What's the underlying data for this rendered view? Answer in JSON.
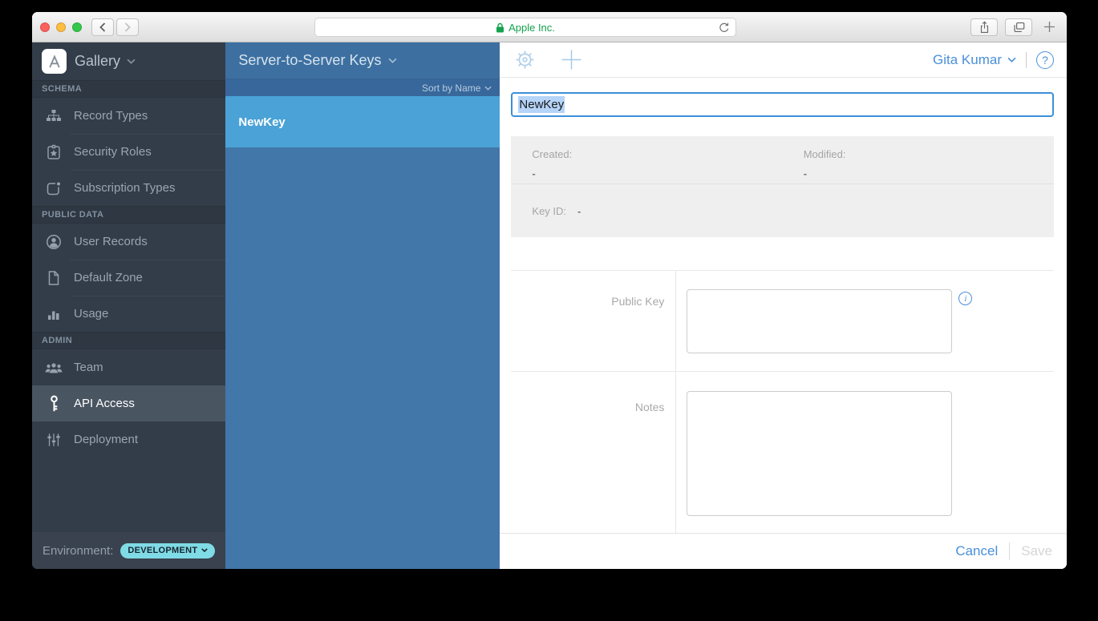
{
  "browser": {
    "address": "Apple Inc."
  },
  "sidebar": {
    "app_menu": "Gallery",
    "sections": [
      {
        "title": "SCHEMA",
        "items": [
          {
            "label": "Record Types",
            "icon": "record-types-icon"
          },
          {
            "label": "Security Roles",
            "icon": "security-roles-icon"
          },
          {
            "label": "Subscription Types",
            "icon": "subscription-types-icon"
          }
        ]
      },
      {
        "title": "PUBLIC DATA",
        "items": [
          {
            "label": "User Records",
            "icon": "user-records-icon"
          },
          {
            "label": "Default Zone",
            "icon": "default-zone-icon"
          },
          {
            "label": "Usage",
            "icon": "usage-icon"
          }
        ]
      },
      {
        "title": "ADMIN",
        "items": [
          {
            "label": "Team",
            "icon": "team-icon"
          },
          {
            "label": "API Access",
            "icon": "key-icon",
            "selected": true
          },
          {
            "label": "Deployment",
            "icon": "sliders-icon"
          }
        ]
      }
    ],
    "environment_label": "Environment:",
    "environment_value": "DEVELOPMENT"
  },
  "keys_list": {
    "title": "Server-to-Server Keys",
    "sort_label": "Sort by Name",
    "selected_item": "NewKey"
  },
  "detail": {
    "user_menu": "Gita Kumar",
    "key_name": "NewKey",
    "created_label": "Created:",
    "created_value": "-",
    "modified_label": "Modified:",
    "modified_value": "-",
    "key_id_label": "Key ID:",
    "key_id_value": "-",
    "public_key_label": "Public Key",
    "notes_label": "Notes",
    "cancel_label": "Cancel",
    "save_label": "Save"
  },
  "colors": {
    "accent_blue": "#4A90D9",
    "list_selected_blue": "#4AA2D7",
    "list_header_blue": "#3D70A1",
    "list_bg_blue": "#4277A9",
    "sidebar_bg": "#333D49",
    "sidebar_selected_bg": "#4A5562",
    "environment_badge": "#7FDBE6",
    "secure_site_green": "#14A24D"
  }
}
